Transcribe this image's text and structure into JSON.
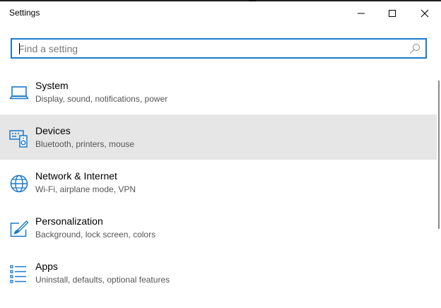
{
  "window": {
    "title": "Settings",
    "minimize_symbol": "–",
    "maximize_symbol": "□",
    "close_symbol": "✕"
  },
  "search": {
    "placeholder": "Find a setting",
    "value": "",
    "icon": "search-icon"
  },
  "categories": [
    {
      "name": "System",
      "description": "Display, sound, notifications, power",
      "icon": "laptop-icon",
      "selected": false
    },
    {
      "name": "Devices",
      "description": "Bluetooth, printers, mouse",
      "icon": "devices-icon",
      "selected": true
    },
    {
      "name": "Network & Internet",
      "description": "Wi-Fi, airplane mode, VPN",
      "icon": "globe-icon",
      "selected": false
    },
    {
      "name": "Personalization",
      "description": "Background, lock screen, colors",
      "icon": "personalization-icon",
      "selected": false
    },
    {
      "name": "Apps",
      "description": "Uninstall, defaults, optional features",
      "icon": "apps-icon",
      "selected": false
    }
  ],
  "colors": {
    "accent": "#1979c9",
    "selected_row": "#e6e6e6"
  }
}
